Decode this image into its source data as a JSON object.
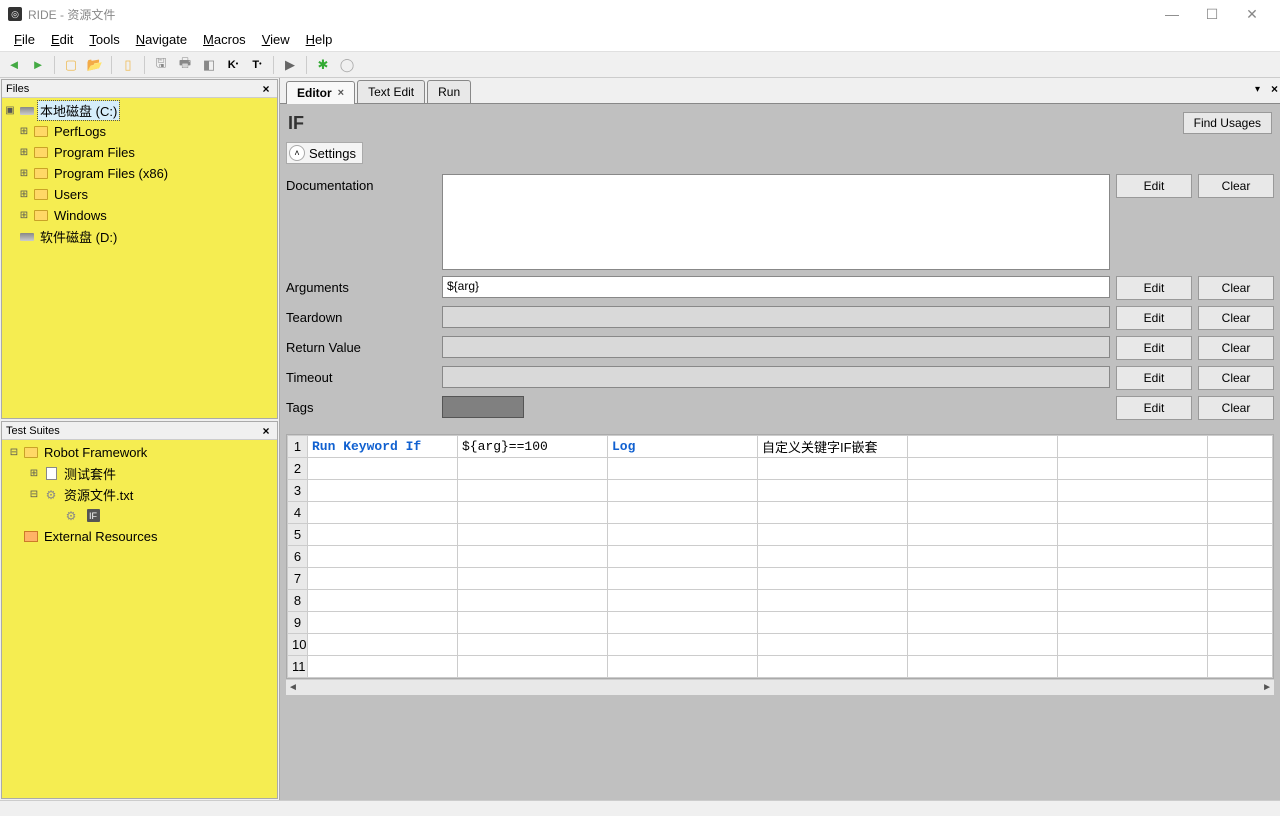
{
  "window": {
    "title": "RIDE - 资源文件"
  },
  "menu": {
    "file": "File",
    "edit": "Edit",
    "tools": "Tools",
    "navigate": "Navigate",
    "macros": "Macros",
    "view": "View",
    "help": "Help"
  },
  "panels": {
    "files_title": "Files",
    "suites_title": "Test Suites"
  },
  "files_tree": {
    "root": "本地磁盘 (C:)",
    "children": [
      "PerfLogs",
      "Program Files",
      "Program Files (x86)",
      "Users",
      "Windows"
    ],
    "drive2": "软件磁盘 (D:)"
  },
  "suites_tree": {
    "root": "Robot Framework",
    "suite": "测试套件",
    "resource": "资源文件.txt",
    "keyword": "IF",
    "external": "External Resources"
  },
  "tabs": {
    "editor": "Editor",
    "text_edit": "Text Edit",
    "run": "Run"
  },
  "editor": {
    "kw_name": "IF",
    "find_usages": "Find Usages",
    "settings_label": "Settings",
    "rows": {
      "documentation": "Documentation",
      "arguments": "Arguments",
      "teardown": "Teardown",
      "return_value": "Return Value",
      "timeout": "Timeout",
      "tags": "Tags"
    },
    "values": {
      "arguments": "${arg}"
    },
    "buttons": {
      "edit": "Edit",
      "clear": "Clear"
    }
  },
  "grid": {
    "row1": {
      "c1": "Run Keyword If",
      "c2": "${arg}==100",
      "c3": "Log",
      "c4": "自定义关键字IF嵌套"
    },
    "row_count": 11
  }
}
